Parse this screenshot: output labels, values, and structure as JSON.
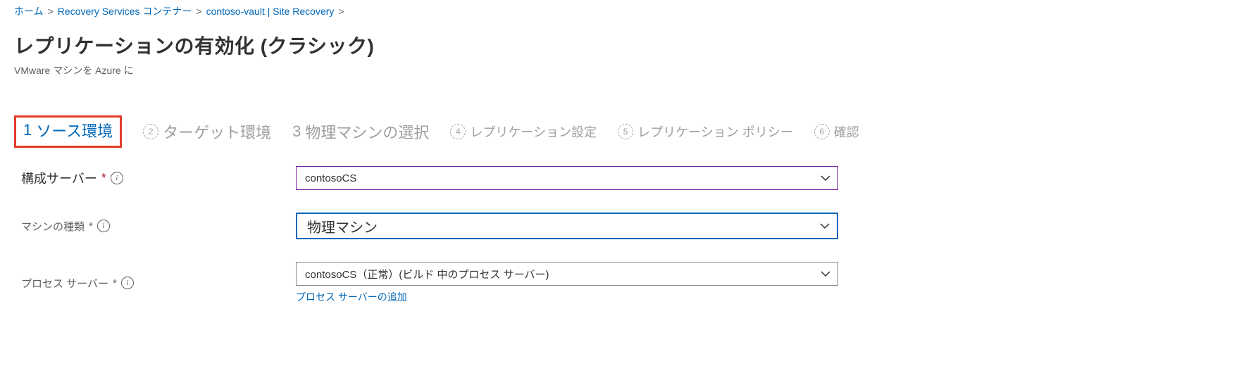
{
  "breadcrumb": {
    "home": "ホーム",
    "rs_containers": "Recovery Services コンテナー",
    "vault": "contoso-vault | Site Recovery"
  },
  "header": {
    "title": "レプリケーションの有効化 (クラシック)",
    "subtitle": "VMware マシンを Azure に"
  },
  "steps": {
    "s1_num": "1",
    "s1": "ソース環境",
    "s2_num": "2",
    "s2": "ターゲット環境",
    "s3_num": "3",
    "s3": "物理マシンの選択",
    "s4_num": "4",
    "s4": "レプリケーション設定",
    "s5_num": "5",
    "s5": "レプリケーション ポリシー",
    "s6_num": "6",
    "s6": "確認"
  },
  "form": {
    "config_server_label": "構成サーバー",
    "config_server_value": "contosoCS",
    "machine_type_label": "マシンの種類",
    "machine_type_value": "物理マシン",
    "process_server_label": "プロセス サーバー",
    "process_server_value": "contosoCS（正常）(ビルド 中のプロセス サーバー)",
    "add_process_server_link": "プロセス サーバーの追加",
    "required_mark": "*"
  }
}
